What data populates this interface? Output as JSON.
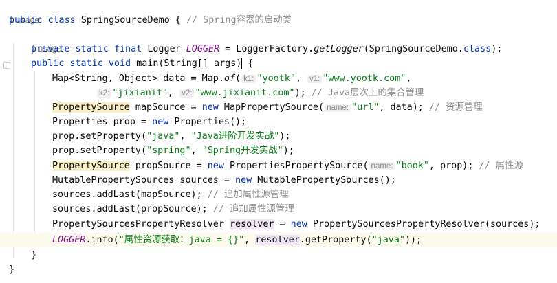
{
  "usage_top": "1 usage",
  "usage_logger": "1 usage",
  "class_decl": {
    "public": "public",
    "class": "class",
    "name": "SpringSourceDemo",
    "brace": " {",
    "comment": "// Spring容器的启动类"
  },
  "logger_line": {
    "private": "private",
    "static": "static",
    "final": "final",
    "type": "Logger",
    "field": "LOGGER",
    "eq": " = LoggerFactory.",
    "method": "getLogger",
    "args": "(SpringSourceDemo.",
    "cls": "class",
    "end": ");"
  },
  "main_line": {
    "public": "public",
    "static": "static",
    "void": "void",
    "sig": "main(String[] args)",
    "brace": " {"
  },
  "map_line1": {
    "code": "Map<String, Object> data = Map.",
    "of": "of",
    "paren": "(",
    "hint_k1": "k1:",
    "v_k1": "\"yootk\"",
    "comma": ", ",
    "hint_v1": "v1:",
    "v_v1": "\"www.yootk.com\"",
    "end": ","
  },
  "map_line2": {
    "hint_k2": "k2:",
    "v_k2": "\"jixianit\"",
    "comma": ", ",
    "hint_v2": "v2:",
    "v_v2": "\"www.jixianit.com\"",
    "end": "); ",
    "comment": "// Java层次上的集合管理"
  },
  "ps_line1": {
    "type": "PropertySource",
    "code": " mapSource = ",
    "new": "new",
    "cls": " MapPropertySource(",
    "hint": "name:",
    "arg": "\"url\"",
    "end": ", data); ",
    "comment": "// 资源管理"
  },
  "prop_line": {
    "code": "Properties prop = ",
    "new": "new",
    "end": " Properties();"
  },
  "set1": {
    "code": "prop.setProperty(",
    "k": "\"java\"",
    "sep": ", ",
    "v": "\"Java进阶开发实战\"",
    "end": ");"
  },
  "set2": {
    "code": "prop.setProperty(",
    "k": "\"spring\"",
    "sep": ", ",
    "v": "\"Spring开发实战\"",
    "end": ");"
  },
  "ps_line2": {
    "type": "PropertySource",
    "code": " propSource = ",
    "new": "new",
    "cls": " PropertiesPropertySource(",
    "hint": "name:",
    "arg": "\"book\"",
    "end": ", prop); ",
    "comment": "// 属性源"
  },
  "mps_line": {
    "code": "MutablePropertySources sources = ",
    "new": "new",
    "end": " MutablePropertySources();"
  },
  "add1": {
    "code": "sources.addLast(mapSource); ",
    "comment": "// 追加属性源管理"
  },
  "add2": {
    "code": "sources.addLast(propSource); ",
    "comment": "// 追加属性源管理"
  },
  "resolver_line": {
    "code": "PropertySourcesPropertyResolver ",
    "var": "resolver",
    "eq": " = ",
    "new": "new",
    "end": " PropertySourcesPropertyResolver(sources);"
  },
  "log_line": {
    "field": "LOGGER",
    "code": ".info(",
    "str": "\"属性资源获取：java = {}\"",
    "sep": ", ",
    "var": "resolver",
    "call": ".getProperty(",
    "arg": "\"java\"",
    "end": "));"
  },
  "close_method": "}",
  "close_class": "}"
}
